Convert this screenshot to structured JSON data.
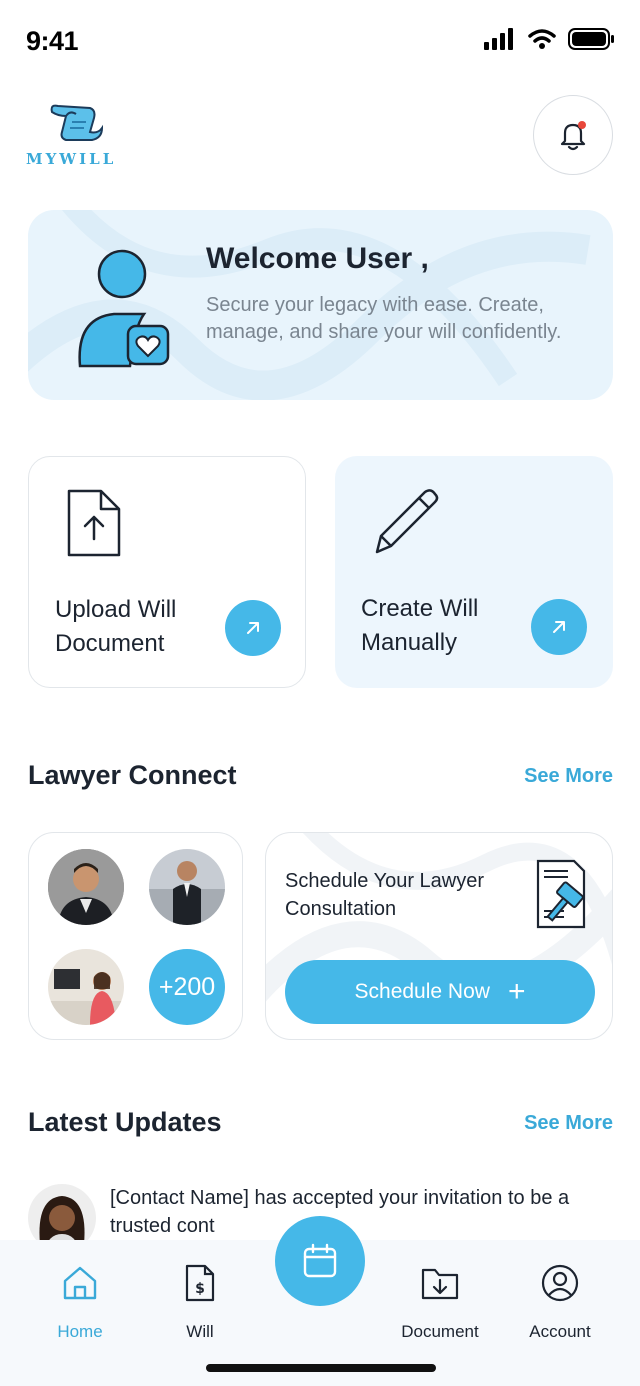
{
  "status_bar": {
    "time": "9:41"
  },
  "brand": {
    "logo_text": "MYWILL",
    "accent_color": "#45b8e8"
  },
  "welcome": {
    "title": "Welcome User ,",
    "subtitle": "Secure your legacy with ease. Create, manage, and share your will confidently."
  },
  "actions": [
    {
      "label": "Upload Will Document",
      "icon": "upload-file-icon"
    },
    {
      "label": "Create Will Manually",
      "icon": "pencil-icon"
    }
  ],
  "lawyer_connect": {
    "title": "Lawyer Connect",
    "see_more": "See More",
    "lawyer_count_badge": "+200",
    "schedule_text": "Schedule Your Lawyer Consultation",
    "schedule_button": "Schedule Now",
    "schedule_button_icon": "+"
  },
  "latest_updates": {
    "title": "Latest Updates",
    "see_more": "See More",
    "items": [
      {
        "text": "[Contact Name] has accepted your invitation to be a trusted cont"
      }
    ]
  },
  "tabbar": {
    "tabs": [
      {
        "label": "Home",
        "icon": "home-icon",
        "active": true
      },
      {
        "label": "Will",
        "icon": "dollar-document-icon",
        "active": false
      },
      {
        "label": "Document",
        "icon": "folder-download-icon",
        "active": false
      },
      {
        "label": "Account",
        "icon": "account-icon",
        "active": false
      }
    ],
    "center_icon": "calendar-icon"
  }
}
